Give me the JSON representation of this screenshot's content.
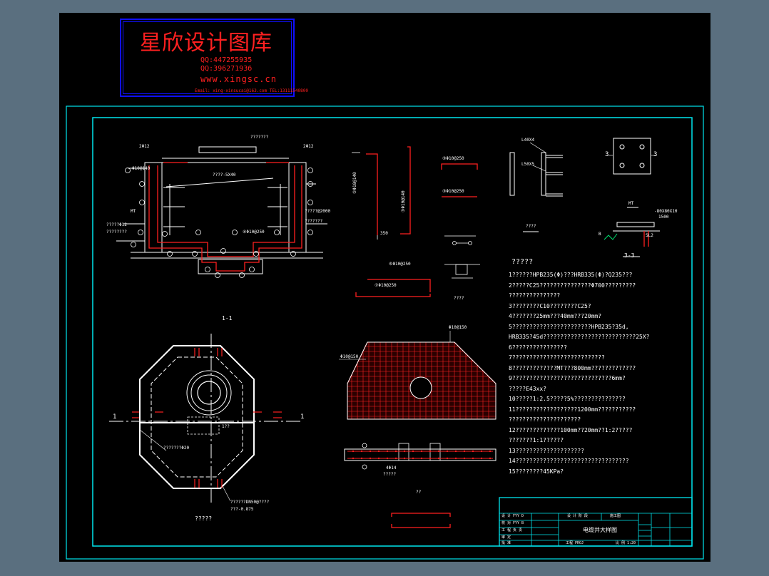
{
  "logo": {
    "title": "星欣设计图库",
    "qq1": "QQ:447255935",
    "qq2": "QQ:39627193б",
    "web": "www.xingsc.cn",
    "email": "Email: xing-xinsucai@163.com  TEL:13111540800"
  },
  "section_labels": {
    "section_1_1": "1-1",
    "section_3_3": "3-3",
    "marker_1_left": "1",
    "marker_1_right": "1",
    "marker_3_left": "3",
    "marker_3_right": "3",
    "plan_caption": "?????",
    "detail_caption_a": "????",
    "detail_caption_b": "????",
    "mt_label": "MT",
    "mt_label_left": "MT",
    "bottom_piece_label": "??"
  },
  "annotations": {
    "dim_350": "350",
    "rebar_a": "③Φ10@250",
    "rebar_b": "③Φ10@250",
    "rebar_c": "⑥Φ10@250",
    "rebar_d": "⑦Φ10@250",
    "rebar_e": "Φ10@150",
    "rebar_f": "Φ10@150",
    "rebar_g": "2Φ12",
    "rebar_h": "2Φ12",
    "rebar_i": "④Φ10@250",
    "angle_l40": "L40X4",
    "angle_l50": "L50X5",
    "plate_label": "-80X80X10",
    "dim_1500": "1500",
    "label_b": "B",
    "label_sl2": "SL2"
  },
  "notes": {
    "heading": "?????",
    "lines": [
      "1??????HPB235(Φ)???HRB335(Φ)?Q235???",
      "2?????C25???????????????Φ700?????????",
      "???????????????",
      "3????????C10????????C25?",
      "4???????25mm???40mm???20mm?",
      "5???????????????????????HPB235?35d,",
      "HRB335?45d???????????????????????????25X?",
      "6????????????????",
      "7???????????????????????????",
      "8?????????????MT???800mm?????????????",
      "9?????????????????????????????6mm?",
      "?????E43xx?",
      "10?????1:2.5?????5%???????????????",
      "11??????????????????1200mm???????????",
      "?????????????????????",
      "12?????????????100mm??20mm??1:2?????",
      "???????1:1??????",
      "13????????????????????",
      "14?????????????????????????????????",
      "15????????45KPa?"
    ]
  },
  "title_block": {
    "drawing_name": "电缆井大样图",
    "col1": [
      "设 计 FYY D",
      "校 对 FYY B",
      "工 程 负 责",
      "审 定",
      "批 准"
    ],
    "col2": "设 计 阶 段",
    "col3": "施工图",
    "bottom_left": "工程 PROJ",
    "bottom_mid": "比 例 1:20"
  }
}
